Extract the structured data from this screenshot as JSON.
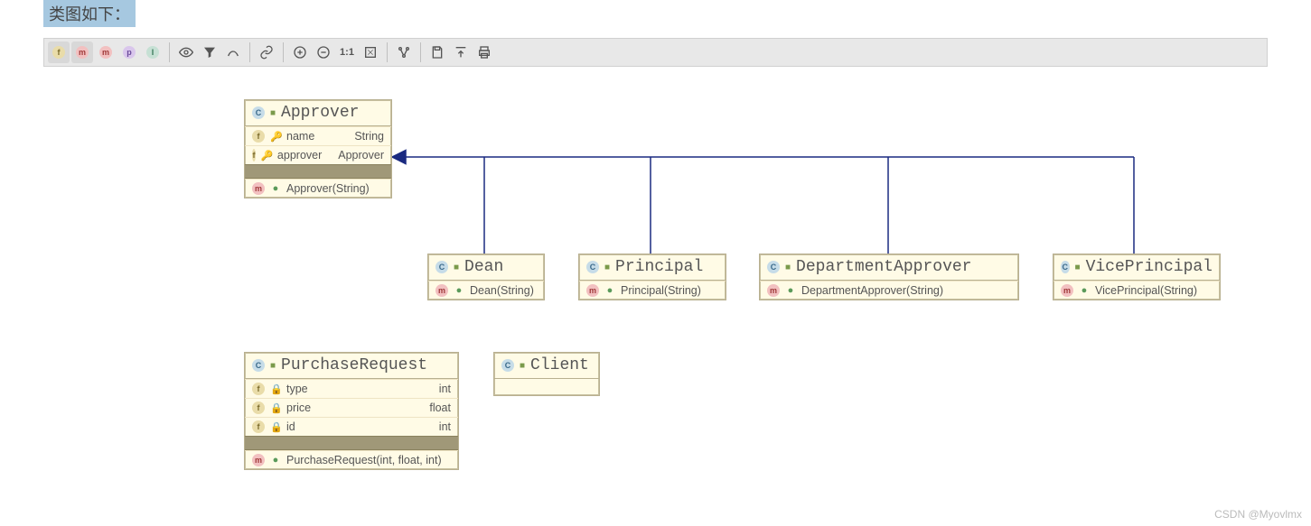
{
  "header_highlight": "类图如下：",
  "toolbar": {
    "f": "f",
    "m_star": "m",
    "m": "m",
    "p": "p",
    "i": "I"
  },
  "classes": {
    "approver": {
      "name": "Approver",
      "fields": [
        {
          "name": "name",
          "type": "String",
          "vis": "protected"
        },
        {
          "name": "approver",
          "type": "Approver",
          "vis": "protected"
        }
      ],
      "methods": [
        {
          "sig": "Approver(String)",
          "vis": "public"
        }
      ]
    },
    "dean": {
      "name": "Dean",
      "methods": [
        {
          "sig": "Dean(String)",
          "vis": "public"
        }
      ]
    },
    "principal": {
      "name": "Principal",
      "methods": [
        {
          "sig": "Principal(String)",
          "vis": "public"
        }
      ]
    },
    "dept": {
      "name": "DepartmentApprover",
      "methods": [
        {
          "sig": "DepartmentApprover(String)",
          "vis": "public"
        }
      ]
    },
    "vice": {
      "name": "VicePrincipal",
      "methods": [
        {
          "sig": "VicePrincipal(String)",
          "vis": "public"
        }
      ]
    },
    "purchase": {
      "name": "PurchaseRequest",
      "fields": [
        {
          "name": "type",
          "type": "int",
          "vis": "private"
        },
        {
          "name": "price",
          "type": "float",
          "vis": "private"
        },
        {
          "name": "id",
          "type": "int",
          "vis": "private"
        }
      ],
      "methods": [
        {
          "sig": "PurchaseRequest(int, float, int)",
          "vis": "public"
        }
      ]
    },
    "client": {
      "name": "Client"
    }
  },
  "chart_data": {
    "type": "diagram",
    "diagram_kind": "uml_class",
    "classes": [
      {
        "name": "Approver",
        "stereotype": "abstract_class",
        "fields": [
          {
            "name": "name",
            "type": "String",
            "visibility": "protected"
          },
          {
            "name": "approver",
            "type": "Approver",
            "visibility": "protected"
          }
        ],
        "methods": [
          {
            "signature": "Approver(String)",
            "visibility": "public"
          }
        ]
      },
      {
        "name": "Dean",
        "methods": [
          {
            "signature": "Dean(String)",
            "visibility": "public"
          }
        ]
      },
      {
        "name": "Principal",
        "methods": [
          {
            "signature": "Principal(String)",
            "visibility": "public"
          }
        ]
      },
      {
        "name": "DepartmentApprover",
        "methods": [
          {
            "signature": "DepartmentApprover(String)",
            "visibility": "public"
          }
        ]
      },
      {
        "name": "VicePrincipal",
        "methods": [
          {
            "signature": "VicePrincipal(String)",
            "visibility": "public"
          }
        ]
      },
      {
        "name": "PurchaseRequest",
        "fields": [
          {
            "name": "type",
            "type": "int",
            "visibility": "private"
          },
          {
            "name": "price",
            "type": "float",
            "visibility": "private"
          },
          {
            "name": "id",
            "type": "int",
            "visibility": "private"
          }
        ],
        "methods": [
          {
            "signature": "PurchaseRequest(int, float, int)",
            "visibility": "public"
          }
        ]
      },
      {
        "name": "Client"
      }
    ],
    "relations": [
      {
        "from": "Dean",
        "to": "Approver",
        "kind": "generalization"
      },
      {
        "from": "Principal",
        "to": "Approver",
        "kind": "generalization"
      },
      {
        "from": "DepartmentApprover",
        "to": "Approver",
        "kind": "generalization"
      },
      {
        "from": "VicePrincipal",
        "to": "Approver",
        "kind": "generalization"
      }
    ]
  },
  "watermark": "CSDN @Myovlmx"
}
